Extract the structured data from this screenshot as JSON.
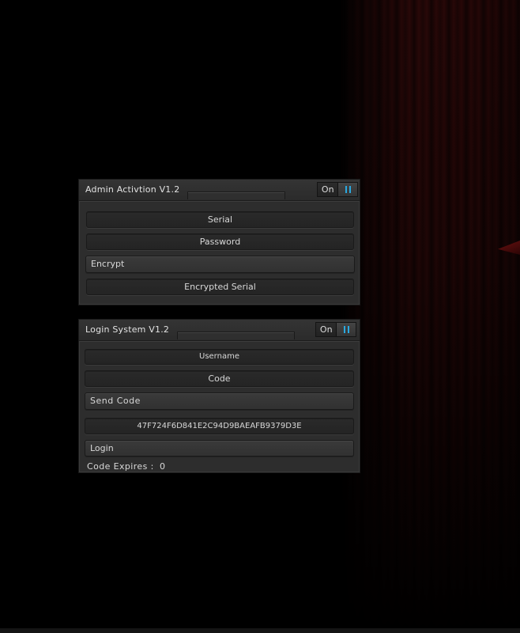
{
  "admin_panel": {
    "title": "Admin Activtion V1.2",
    "toggle_label": "On",
    "serial_placeholder": "Serial",
    "password_placeholder": "Password",
    "encrypt_label": "Encrypt",
    "encrypted_serial_placeholder": "Encrypted  Serial"
  },
  "login_panel": {
    "title": "Login System V1.2",
    "toggle_label": "On",
    "username_placeholder": "Username",
    "code_placeholder": "Code",
    "send_code_label": "Send Code",
    "hash_value": "47F724F6D841E2C94D9BAEAFB9379D3E",
    "login_label": "Login",
    "code_expires_label": "Code Expires :",
    "code_expires_value": "0"
  },
  "colors": {
    "toggle_accent": "#2aa9e0",
    "panel_bg": "#2d2d2d",
    "curtain": "#2a0808"
  },
  "icons": {
    "toggle": "pause-bars-icon"
  }
}
